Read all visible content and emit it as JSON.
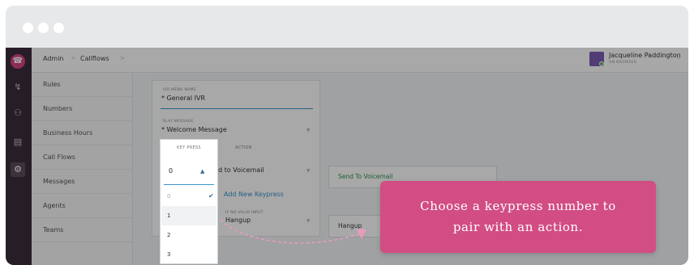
{
  "breadcrumb": {
    "root": "Admin",
    "section": "Callflows",
    "sep": ">"
  },
  "user": {
    "name": "Jacqueline Paddington",
    "status": "ON BROWSER"
  },
  "sidebar": {
    "items": [
      "Rules",
      "Numbers",
      "Business Hours",
      "Call Flows",
      "Messages",
      "Agents",
      "Teams"
    ]
  },
  "form": {
    "menu_name_label": "IVR MENU NAME",
    "menu_name_value": "* General IVR",
    "play_message_label": "PLAY MESSAGE",
    "play_message_value": "* Welcome Message",
    "keypress_header": "KEY PRESS",
    "action_header": "ACTION",
    "action_value": "Send to Voicemail",
    "add_keypress": "Add New Keypress",
    "invalid_label": "IF NO VALID INPUT",
    "invalid_value": "Hangup"
  },
  "side_cards": {
    "voicemail": "Send To Voicemail",
    "hangup": "Hangup"
  },
  "dropdown": {
    "selected": "0",
    "options": [
      "0",
      "1",
      "2",
      "3"
    ]
  },
  "tooltip": {
    "line1": "Choose a keypress number to",
    "line2": "pair with an action."
  },
  "colors": {
    "accent": "#d24d84",
    "rail": "#3b2d3c",
    "link": "#3a93c9",
    "success": "#2f8f4e"
  }
}
